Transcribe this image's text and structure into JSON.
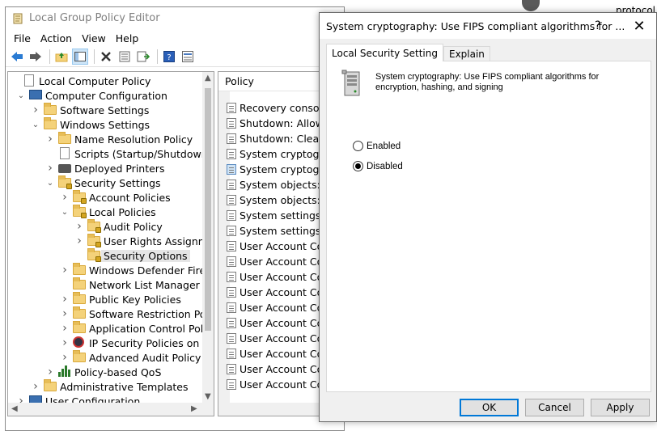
{
  "background": {
    "right_text": "protocol"
  },
  "gp_window": {
    "title": "Local Group Policy Editor",
    "menu": [
      "File",
      "Action",
      "View",
      "Help"
    ],
    "tree": [
      {
        "label": "Local Computer Policy",
        "chevron": "",
        "icon": "computer-policy-icon"
      },
      {
        "label": "Computer Configuration",
        "chevron": "down",
        "icon": "computer-icon"
      },
      {
        "label": "Software Settings",
        "chevron": "right",
        "icon": "folder-icon"
      },
      {
        "label": "Windows Settings",
        "chevron": "down",
        "icon": "folder-icon"
      },
      {
        "label": "Name Resolution Policy",
        "chevron": "right",
        "icon": "folder-icon"
      },
      {
        "label": "Scripts (Startup/Shutdown)",
        "chevron": "",
        "icon": "scripts-icon"
      },
      {
        "label": "Deployed Printers",
        "chevron": "right",
        "icon": "printer-icon"
      },
      {
        "label": "Security Settings",
        "chevron": "down",
        "icon": "security-folder-icon"
      },
      {
        "label": "Account Policies",
        "chevron": "right",
        "icon": "security-folder-icon"
      },
      {
        "label": "Local Policies",
        "chevron": "down",
        "icon": "security-folder-icon"
      },
      {
        "label": "Audit Policy",
        "chevron": "right",
        "icon": "security-folder-icon"
      },
      {
        "label": "User Rights Assignmer",
        "chevron": "right",
        "icon": "security-folder-icon"
      },
      {
        "label": "Security Options",
        "chevron": "",
        "icon": "security-folder-icon",
        "selected": true
      },
      {
        "label": "Windows Defender Firewa",
        "chevron": "right",
        "icon": "folder-icon"
      },
      {
        "label": "Network List Manager Poli",
        "chevron": "",
        "icon": "folder-icon"
      },
      {
        "label": "Public Key Policies",
        "chevron": "right",
        "icon": "folder-icon"
      },
      {
        "label": "Software Restriction Polici",
        "chevron": "right",
        "icon": "folder-icon"
      },
      {
        "label": "Application Control Policie",
        "chevron": "right",
        "icon": "folder-icon"
      },
      {
        "label": "IP Security Policies on Loc",
        "chevron": "right",
        "icon": "ipsec-icon"
      },
      {
        "label": "Advanced Audit Policy Co",
        "chevron": "right",
        "icon": "folder-icon"
      },
      {
        "label": "Policy-based QoS",
        "chevron": "right",
        "icon": "chart-icon"
      },
      {
        "label": "Administrative Templates",
        "chevron": "right",
        "icon": "folder-icon"
      },
      {
        "label": "User Configuration",
        "chevron": "right",
        "icon": "user-icon"
      }
    ],
    "list_header": "Policy",
    "policies": [
      {
        "label": "Recovery console: A"
      },
      {
        "label": "Shutdown: Allow sy"
      },
      {
        "label": "Shutdown: Clear vir"
      },
      {
        "label": "System cryptograph"
      },
      {
        "label": "System cryptograph",
        "selected": true
      },
      {
        "label": "System objects: Rec"
      },
      {
        "label": "System objects: Stre"
      },
      {
        "label": "System settings: Op"
      },
      {
        "label": "System settings: Us"
      },
      {
        "label": "User Account Contr"
      },
      {
        "label": "User Account Contr"
      },
      {
        "label": "User Account Contr"
      },
      {
        "label": "User Account Contr"
      },
      {
        "label": "User Account Contr"
      },
      {
        "label": "User Account Contr"
      },
      {
        "label": "User Account Contr"
      },
      {
        "label": "User Account Contr"
      },
      {
        "label": "User Account Contr"
      },
      {
        "label": "User Account Contr"
      }
    ]
  },
  "dialog": {
    "title": "System cryptography: Use FIPS compliant algorithms for ...",
    "help": "?",
    "close": "✕",
    "tabs": [
      "Local Security Setting",
      "Explain"
    ],
    "description": "System cryptography: Use FIPS compliant algorithms for encryption, hashing, and signing",
    "options": [
      {
        "label": "Enabled",
        "checked": false
      },
      {
        "label": "Disabled",
        "checked": true
      }
    ],
    "buttons": {
      "ok": "OK",
      "cancel": "Cancel",
      "apply": "Apply"
    }
  }
}
